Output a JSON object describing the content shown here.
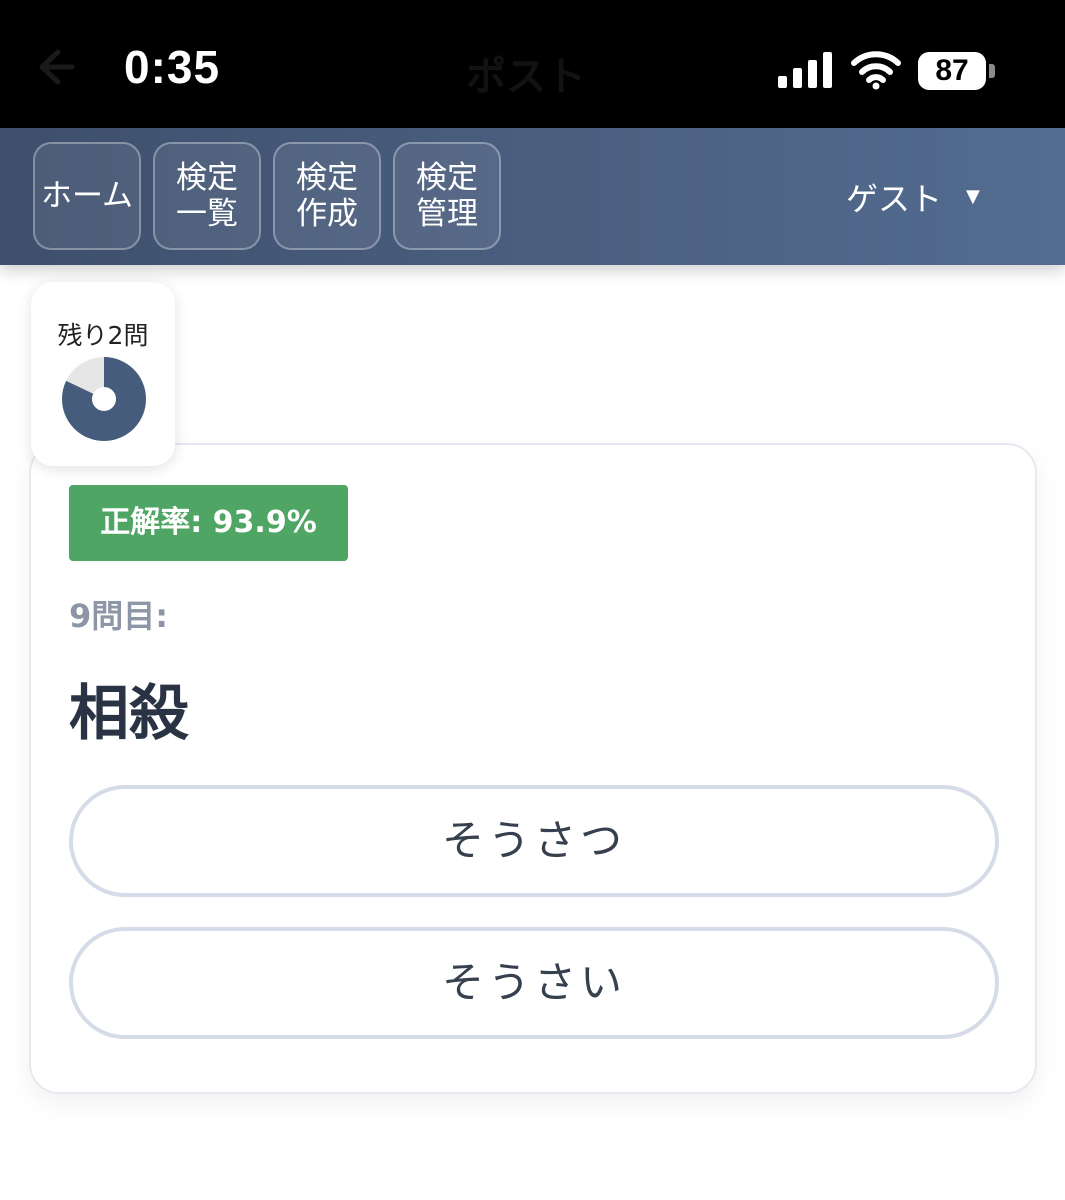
{
  "status_bar": {
    "time": "0:35",
    "title": "ポスト",
    "battery": "87",
    "icons": [
      "back-arrow-icon",
      "cellular-signal-icon",
      "wifi-icon",
      "battery-icon"
    ]
  },
  "nav": {
    "buttons": [
      {
        "line1": "ホーム",
        "line2": ""
      },
      {
        "line1": "検定",
        "line2": "一覧"
      },
      {
        "line1": "検定",
        "line2": "作成"
      },
      {
        "line1": "検定",
        "line2": "管理"
      }
    ],
    "user": "ゲスト",
    "user_caret": "▼"
  },
  "progress": {
    "remaining_label": "残り2問",
    "completed_fraction": 0.82,
    "colors": {
      "done": "#465c7d",
      "remaining": "#e6e6e6"
    }
  },
  "quiz": {
    "accuracy": "正解率: 93.9%",
    "question_number": "9問目:",
    "word": "相殺",
    "choices": [
      "そうさつ",
      "そうさい"
    ]
  },
  "colors": {
    "nav_gradient_start": "#3d4f6c",
    "nav_gradient_end": "#536c91",
    "accuracy_badge": "#4ea564",
    "choice_border": "#d6dce7"
  }
}
